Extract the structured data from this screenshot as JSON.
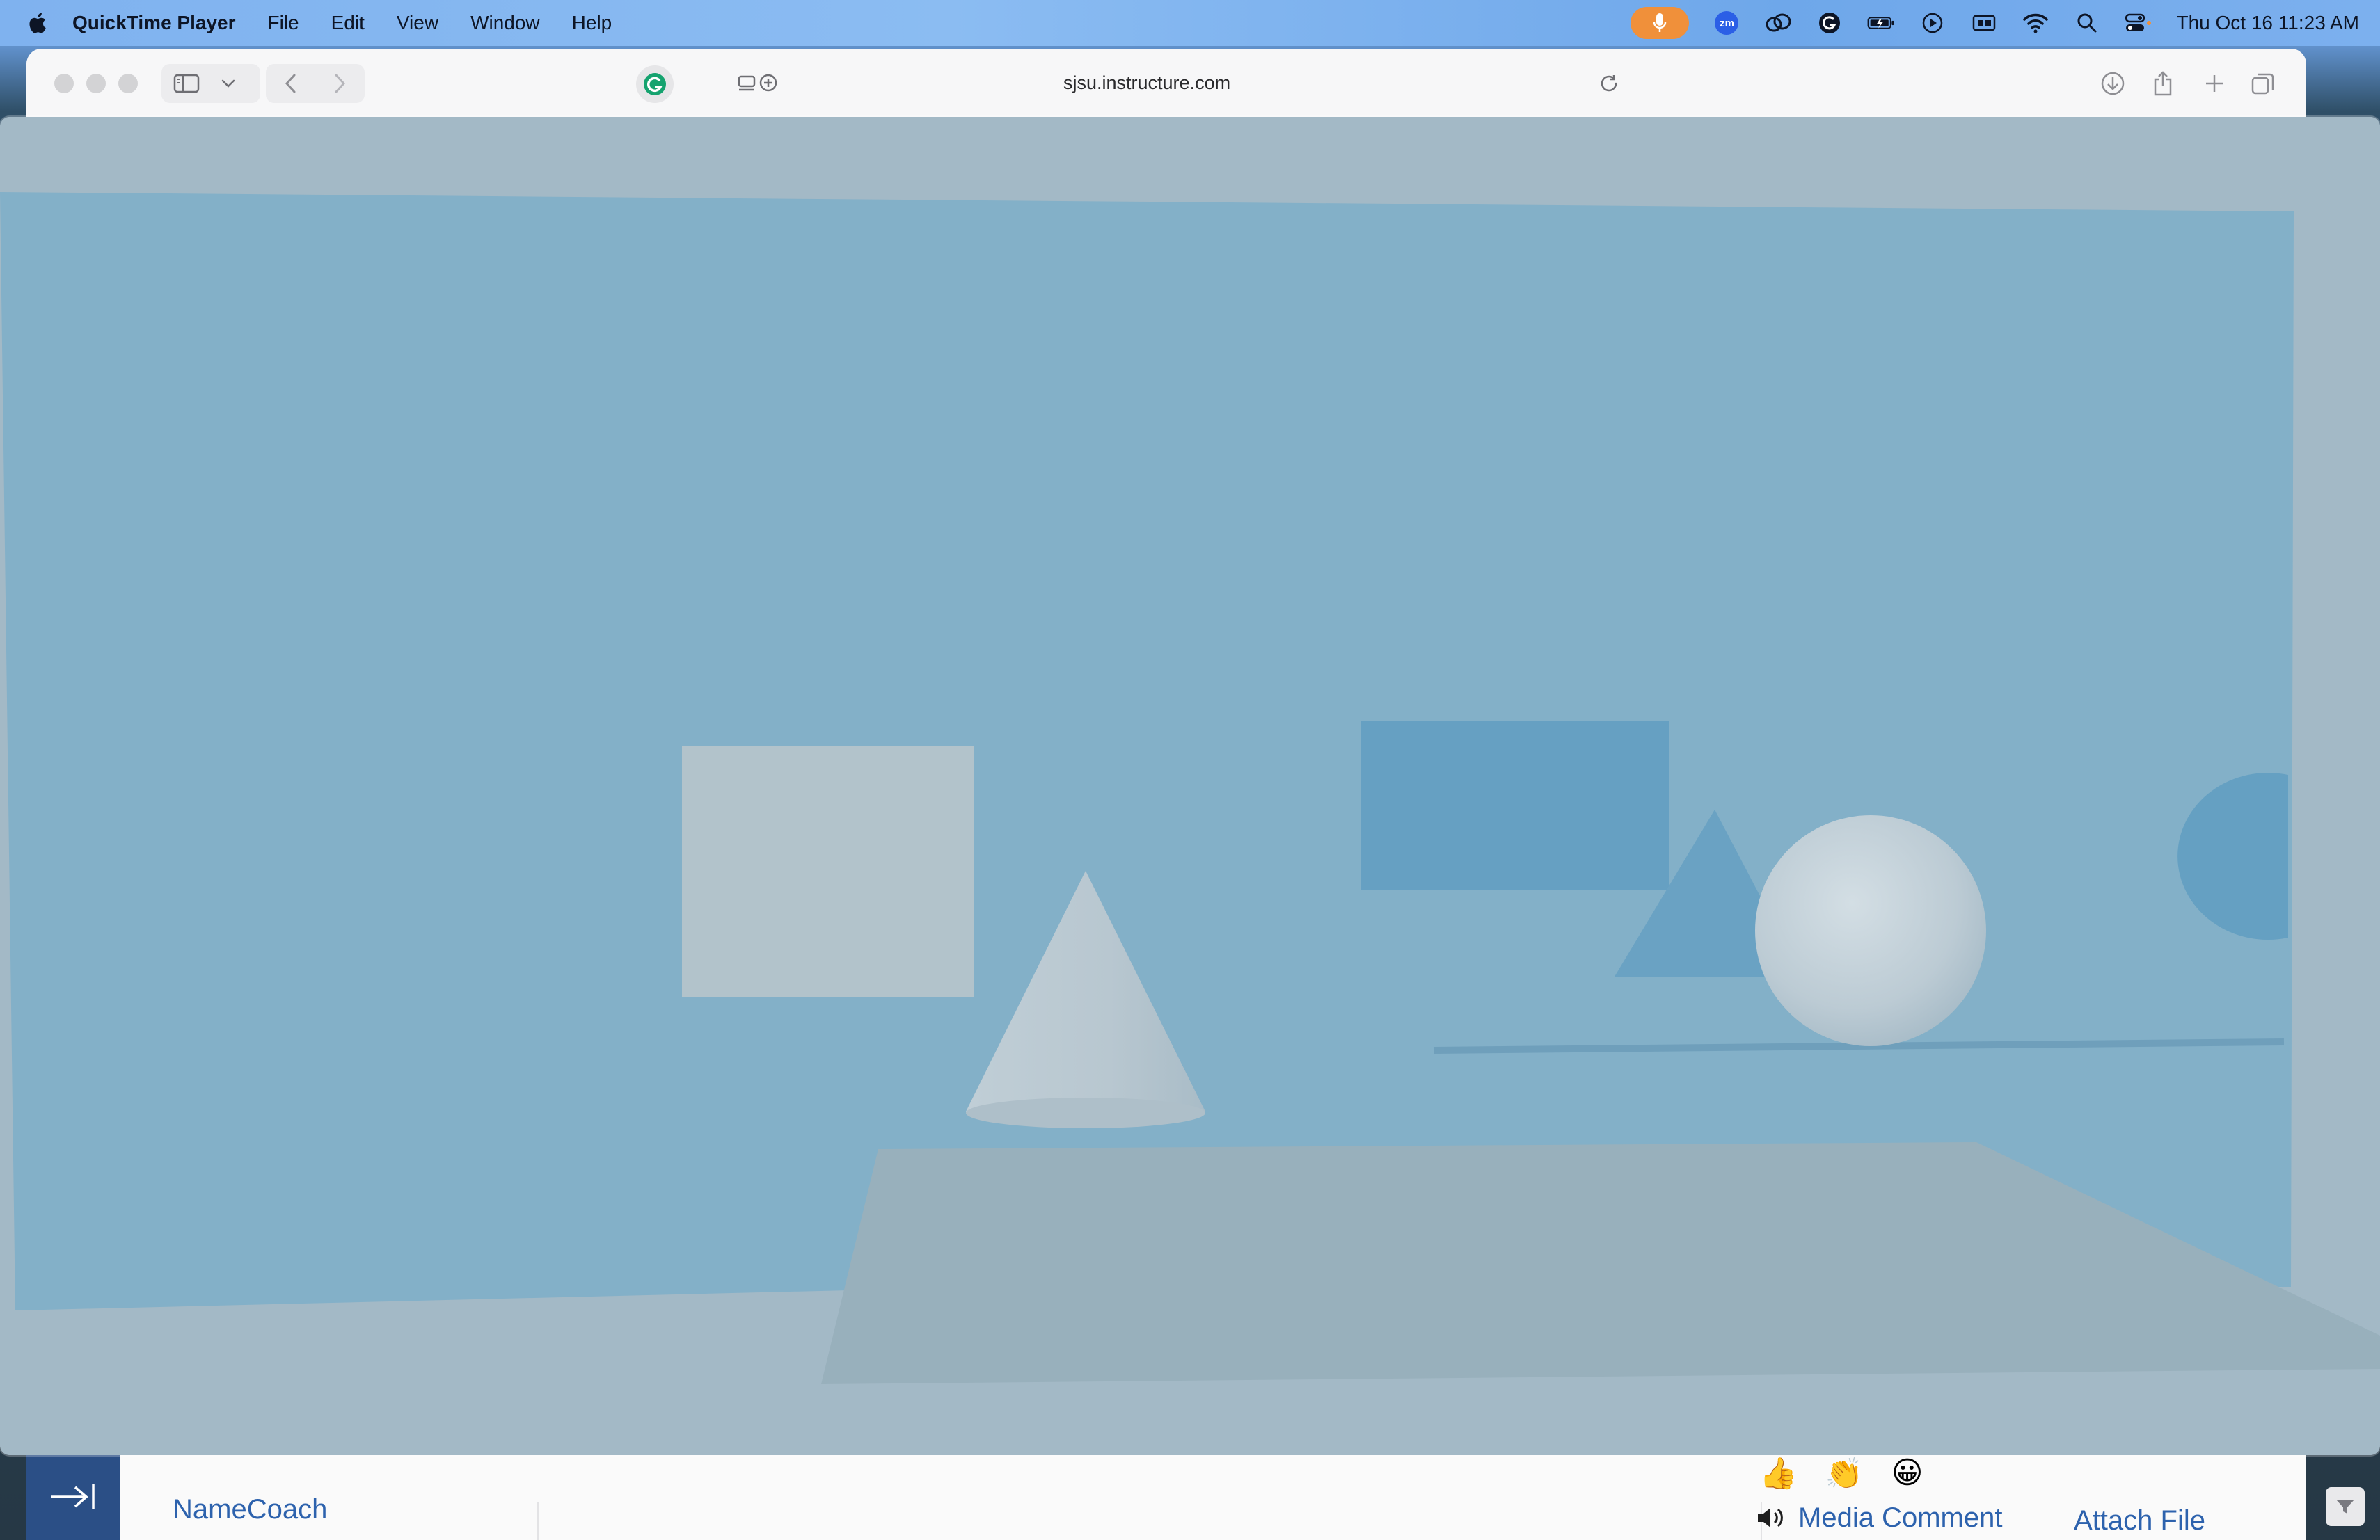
{
  "menubar": {
    "apple_icon": "apple-logo-icon",
    "app_name": "QuickTime Player",
    "items": [
      {
        "label": "File"
      },
      {
        "label": "Edit"
      },
      {
        "label": "View"
      },
      {
        "label": "Window"
      },
      {
        "label": "Help"
      }
    ],
    "status_icons": [
      "microphone-icon",
      "zoom-icon",
      "creative-cloud-icon",
      "grammarly-icon",
      "battery-charging-icon",
      "play-circle-icon",
      "display-icon",
      "wifi-icon",
      "search-icon",
      "control-center-icon"
    ],
    "clock": "Thu Oct 16  11:23 AM",
    "mic_color": "#f0903a"
  },
  "browser": {
    "url": "sjsu.instructure.com",
    "toolbar_icons": [
      "sidebar-icon",
      "chevron-down-icon",
      "back-icon",
      "forward-icon",
      "grammarly-icon",
      "reader-icon",
      "reload-icon",
      "download-icon",
      "share-icon",
      "new-tab-icon",
      "tab-overview-icon"
    ]
  },
  "page": {
    "collapse_icon": "collapse-right-icon",
    "namecoach": "NameCoach",
    "reactions": [
      "👍",
      "👏",
      "😀"
    ],
    "media_comment": "Media Comment",
    "attach_file": "Attach File",
    "link_color": "#2d62ad",
    "collapse_color": "#2b4f86"
  },
  "video": {
    "scene_background": "#a3b9c6",
    "wall_color": "#83b0c8",
    "shapes": [
      "square",
      "cone",
      "rectangle",
      "triangle",
      "sphere",
      "circle",
      "floor-plane"
    ]
  }
}
